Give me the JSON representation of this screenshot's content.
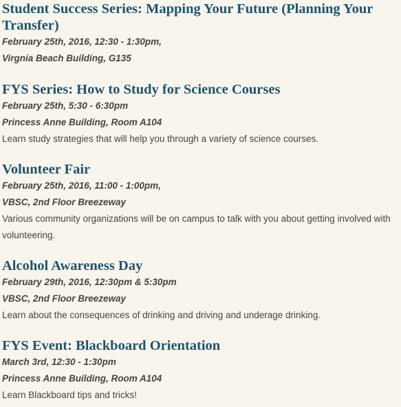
{
  "events": [
    {
      "title": "Student Success Series: Mapping Your Future (Planning Your Transfer)",
      "date": "February 25th, 2016, 12:30 - 1:30pm,",
      "location": "Virgnia Beach Building, G135",
      "description": ""
    },
    {
      "title": "FYS Series: How to Study for Science Courses",
      "date": "February 25th, 5:30 - 6:30pm",
      "location": "Princess Anne Building, Room A104",
      "description": "Learn study strategies that will help you through a variety of science courses."
    },
    {
      "title": "Volunteer Fair",
      "date": "February 25th, 2016, 11:00 - 1:00pm,",
      "location": "VBSC, 2nd Floor Breezeway",
      "description": "Various community organizations will be on campus to talk with you about getting involved with volunteering."
    },
    {
      "title": "Alcohol Awareness Day",
      "date": "February 29th, 2016, 12:30pm & 5:30pm",
      "location": "VBSC, 2nd Floor Breezeway",
      "description": "Learn about the consequences of drinking and driving and underage drinking."
    },
    {
      "title": "FYS Event: Blackboard Orientation",
      "date": "March 3rd, 12:30 - 1:30pm",
      "location": "Princess Anne Building, Room A104",
      "description": "Learn Blackboard tips and tricks!"
    }
  ]
}
